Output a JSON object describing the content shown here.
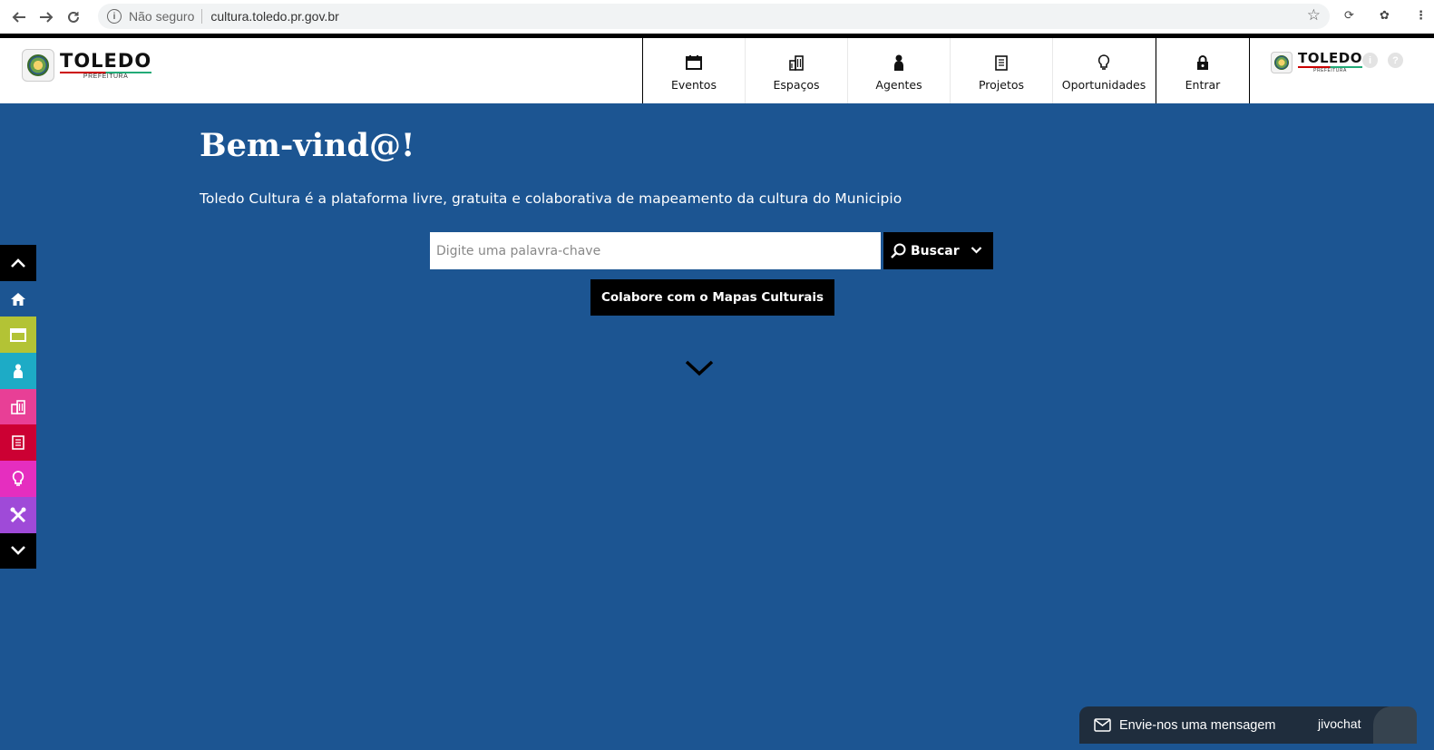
{
  "browser": {
    "security_label": "Não seguro",
    "url": "cultura.toledo.pr.gov.br"
  },
  "header": {
    "logo": {
      "main": "TOLEDO",
      "sub": "PREFEITURA"
    },
    "nav": [
      {
        "label": "Eventos",
        "icon": "calendar-icon"
      },
      {
        "label": "Espaços",
        "icon": "building-icon"
      },
      {
        "label": "Agentes",
        "icon": "person-icon"
      },
      {
        "label": "Projetos",
        "icon": "document-icon"
      },
      {
        "label": "Oportunidades",
        "icon": "lightbulb-icon"
      }
    ],
    "login_label": "Entrar",
    "logo_secondary": {
      "main": "TOLEDO",
      "sub": "PREFEITURA"
    }
  },
  "hero": {
    "title": "Bem-vind@!",
    "subtitle": "Toledo Cultura é a plataforma livre, gratuita e colaborativa de mapeamento da cultura do Municipio",
    "search_placeholder": "Digite uma palavra-chave",
    "search_button": "Buscar",
    "collab_button": "Colabore com o Mapas Culturais"
  },
  "sidebar": {
    "items": [
      {
        "icon": "chevron-up-icon",
        "color": "#000000"
      },
      {
        "icon": "home-icon",
        "color": "#1c5592"
      },
      {
        "icon": "calendar-icon",
        "color": "#b3c335"
      },
      {
        "icon": "person-icon",
        "color": "#1dabc6"
      },
      {
        "icon": "building-icon",
        "color": "#e83f96"
      },
      {
        "icon": "document-icon",
        "color": "#cc0033"
      },
      {
        "icon": "lightbulb-icon",
        "color": "#e52ebf"
      },
      {
        "icon": "tools-icon",
        "color": "#9f4ad8"
      },
      {
        "icon": "chevron-down-icon",
        "color": "#000000"
      }
    ]
  },
  "chat": {
    "label": "Envie-nos uma mensagem",
    "brand": "jivochat"
  },
  "colors": {
    "hero_background": "#1c5592",
    "header_background": "#ffffff",
    "button_background": "#000000"
  }
}
